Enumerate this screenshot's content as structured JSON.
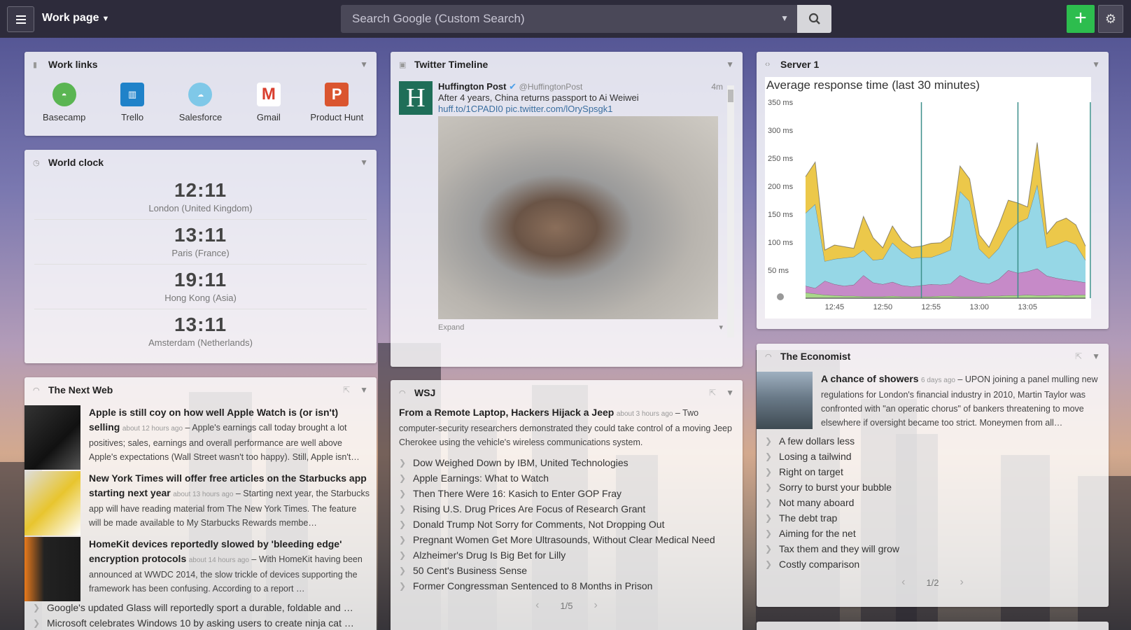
{
  "topbar": {
    "page_title": "Work page",
    "search_placeholder": "Search Google (Custom Search)"
  },
  "work_links": {
    "title": "Work links",
    "items": [
      {
        "label": "Basecamp",
        "icon": "basecamp-icon",
        "color": "#5ab552"
      },
      {
        "label": "Trello",
        "icon": "trello-icon",
        "color": "#1f82c9"
      },
      {
        "label": "Salesforce",
        "icon": "salesforce-icon",
        "color": "#7fc8e8"
      },
      {
        "label": "Gmail",
        "icon": "gmail-icon",
        "color": "#d93f2f"
      },
      {
        "label": "Product Hunt",
        "icon": "product-hunt-icon",
        "color": "#da552f"
      }
    ]
  },
  "world_clock": {
    "title": "World clock",
    "clocks": [
      {
        "time": "12:11",
        "place": "London (United Kingdom)"
      },
      {
        "time": "13:11",
        "place": "Paris (France)"
      },
      {
        "time": "19:11",
        "place": "Hong Kong (Asia)"
      },
      {
        "time": "13:11",
        "place": "Amsterdam (Netherlands)"
      }
    ]
  },
  "next_web": {
    "title": "The Next Web",
    "articles": [
      {
        "title": "Apple is still coy on how well Apple Watch is (or isn't) selling",
        "time": "about 12 hours ago",
        "excerpt": "Apple's earnings call today brought a lot positives; sales, earnings and overall performance are well above Apple's expectations (Wall Street wasn't too happy). Still, Apple isn't…"
      },
      {
        "title": "New York Times will offer free articles on the Starbucks app starting next year",
        "time": "about 13 hours ago",
        "excerpt": "Starting next year, the Starbucks app will have reading material from The New York Times. The feature will be made available to My Starbucks Rewards membe…"
      },
      {
        "title": "HomeKit devices reportedly slowed by 'bleeding edge' encryption protocols",
        "time": "about 14 hours ago",
        "excerpt": "With HomeKit having been announced at WWDC 2014, the slow trickle of devices supporting the framework has been confusing. According to a report …"
      }
    ],
    "list": [
      "Google's updated Glass will reportedly sport a durable, foldable and …",
      "Microsoft celebrates Windows 10 by asking users to create ninja cat …"
    ]
  },
  "twitter": {
    "title": "Twitter Timeline",
    "tweet": {
      "name": "Huffington Post",
      "handle": "@HuffingtonPost",
      "time": "4m",
      "text": "After 4 years, China returns passport to Ai Weiwei",
      "link": "huff.to/1CPADI0 pic.twitter.com/lOrySpsgk1",
      "expand": "Expand"
    }
  },
  "wsj": {
    "title": "WSJ",
    "lead": {
      "title": "From a Remote Laptop, Hackers Hijack a Jeep",
      "time": "about 3 hours ago",
      "excerpt": "Two computer-security researchers demonstrated they could take control of a moving Jeep Cherokee using the vehicle's wireless communications system."
    },
    "list": [
      "Dow Weighed Down by IBM, United Technologies",
      "Apple Earnings: What to Watch",
      "Then There Were 16: Kasich to Enter GOP Fray",
      "Rising U.S. Drug Prices Are Focus of Research Grant",
      "Donald Trump Not Sorry for Comments, Not Dropping Out",
      "Pregnant Women Get More Ultrasounds, Without Clear Medical Need",
      "Alzheimer's Drug Is Big Bet for Lilly",
      "50 Cent's Business Sense",
      "Former Congressman Sentenced to 8 Months in Prison"
    ],
    "pager": "1/5"
  },
  "server": {
    "title": "Server 1"
  },
  "chart_data": {
    "type": "area",
    "title": "Average response time (last 30 minutes)",
    "xlabel": "",
    "ylabel": "",
    "ylim": [
      0,
      350
    ],
    "y_ticks": [
      "50 ms",
      "100 ms",
      "150 ms",
      "200 ms",
      "250 ms",
      "300 ms",
      "350 ms"
    ],
    "x_ticks": [
      "12:45",
      "12:50",
      "12:55",
      "13:00",
      "13:05"
    ],
    "x_minutes": [
      0,
      1,
      2,
      3,
      4,
      5,
      6,
      7,
      8,
      9,
      10,
      11,
      12,
      13,
      14,
      15,
      16,
      17,
      18,
      19,
      20,
      21,
      22,
      23,
      24,
      25,
      26,
      27,
      28,
      29
    ],
    "grid": false,
    "series": [
      {
        "color": "#a9d88a",
        "values": [
          10,
          8,
          6,
          5,
          4,
          4,
          3,
          3,
          3,
          4,
          3,
          3,
          3,
          3,
          4,
          4,
          3,
          3,
          3,
          4,
          4,
          5,
          5,
          6,
          5,
          5,
          6,
          5,
          6,
          6
        ]
      },
      {
        "color": "#c68ac8",
        "values": [
          12,
          10,
          25,
          20,
          18,
          20,
          38,
          25,
          22,
          25,
          20,
          18,
          20,
          22,
          20,
          22,
          38,
          30,
          25,
          22,
          30,
          45,
          40,
          42,
          48,
          35,
          30,
          28,
          25,
          22
        ]
      },
      {
        "color": "#96d7e6",
        "values": [
          130,
          150,
          35,
          45,
          50,
          50,
          45,
          40,
          45,
          70,
          60,
          50,
          50,
          48,
          55,
          60,
          150,
          140,
          60,
          45,
          55,
          70,
          90,
          95,
          150,
          50,
          60,
          70,
          65,
          40
        ]
      },
      {
        "color": "#ecc84a",
        "values": [
          65,
          75,
          20,
          25,
          20,
          15,
          60,
          40,
          20,
          30,
          20,
          20,
          20,
          25,
          20,
          25,
          45,
          40,
          25,
          20,
          40,
          55,
          35,
          20,
          75,
          25,
          40,
          40,
          35,
          25
        ]
      }
    ],
    "markers_x": [
      12.0,
      22.0,
      29.5
    ]
  },
  "economist": {
    "title": "The Economist",
    "lead": {
      "title": "A chance of showers",
      "time": "6 days ago",
      "excerpt": "UPON joining a panel mulling new regulations for London's financial industry in 2010, Martin Taylor was confronted with \"an operatic chorus\" of bankers threatening to move elsewhere if oversight became too strict. Moneymen from all…"
    },
    "list": [
      "A few dollars less",
      "Losing a tailwind",
      "Right on target",
      "Sorry to burst your bubble",
      "Not many aboard",
      "The debt trap",
      "Aiming for the net",
      "Tax them and they will grow",
      "Costly comparison"
    ],
    "pager": "1/2"
  }
}
